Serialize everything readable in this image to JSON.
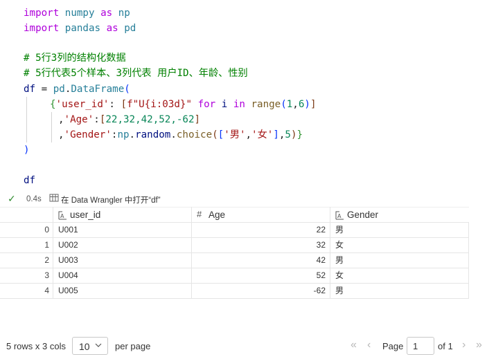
{
  "code": {
    "line1": {
      "kw": "import",
      "mod": "numpy",
      "as": "as",
      "alias": "np"
    },
    "line2": {
      "kw": "import",
      "mod": "pandas",
      "as": "as",
      "alias": "pd"
    },
    "comment1": "# 5行3列的结构化数据",
    "comment2": "# 5行代表5个样本、3列代表 用户ID、年龄、性别",
    "line5": {
      "var": "df",
      "eq": " = ",
      "obj": "pd",
      "dot": ".",
      "fn": "DataFrame",
      "paren": "("
    },
    "line6": {
      "brace": "{",
      "key": "'user_id'",
      "colon": ": ",
      "bracket_open": "[",
      "fstr": "f\"U{i:03d}\"",
      "for": "for",
      "i": "i",
      "in": "in",
      "range": "range",
      "args_open": "(",
      "n1": "1",
      "comma": ",",
      "n2": "6",
      "args_close": ")",
      "bracket_close": "]"
    },
    "line7": {
      "lead": ",",
      "key": "'Age'",
      "colon": ":",
      "bracket_open": "[",
      "nums": "22,32,42,52,-62",
      "bracket_close": "]"
    },
    "line8": {
      "lead": ",",
      "key": "'Gender'",
      "colon": ":",
      "np": "np",
      "dot1": ".",
      "random": "random",
      "dot2": ".",
      "choice": "choice",
      "p_open": "(",
      "b_open": "[",
      "male": "'男'",
      "comma": ",",
      "female": "'女'",
      "b_close": "]",
      "comma2": ",",
      "n": "5",
      "p_close": ")",
      "brace_close": "}"
    },
    "line9": ")",
    "line10": "df"
  },
  "status": {
    "exec_time": "0.4s",
    "wrangler_text": "在 Data Wrangler 中打开“df”",
    "wrangler_icon": "data-wrangler-icon",
    "check_icon": "check-icon"
  },
  "table": {
    "columns": [
      {
        "name": "user_id",
        "type_icon": "abc"
      },
      {
        "name": "Age",
        "type_icon": "#"
      },
      {
        "name": "Gender",
        "type_icon": "abc"
      }
    ],
    "rows": [
      {
        "idx": "0",
        "user_id": "U001",
        "age": "22",
        "gender": "男"
      },
      {
        "idx": "1",
        "user_id": "U002",
        "age": "32",
        "gender": "女"
      },
      {
        "idx": "2",
        "user_id": "U003",
        "age": "42",
        "gender": "男"
      },
      {
        "idx": "3",
        "user_id": "U004",
        "age": "52",
        "gender": "女"
      },
      {
        "idx": "4",
        "user_id": "U005",
        "age": "-62",
        "gender": "男"
      }
    ]
  },
  "pager": {
    "summary": "5 rows x 3 cols",
    "page_size": "10",
    "per_page": "per page",
    "page_label": "Page",
    "page_value": "1",
    "of_label": "of 1"
  }
}
